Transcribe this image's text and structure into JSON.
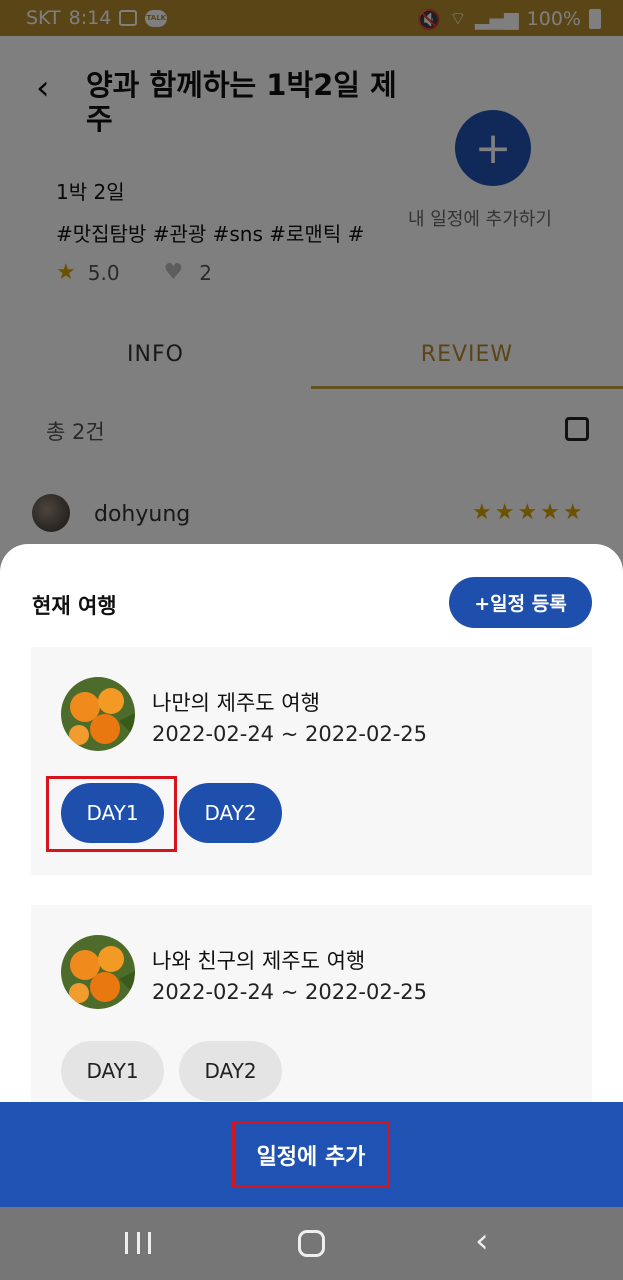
{
  "status_bar": {
    "carrier": "SKT",
    "time": "8:14",
    "battery": "100%",
    "talk_label": "TALK",
    "icons": [
      "gallery-icon",
      "kakaotalk-icon",
      "mute-icon",
      "wifi-icon",
      "signal-icon",
      "battery-icon"
    ]
  },
  "header": {
    "title": "양과 함께하는 1박2일 제주",
    "add_plan_label": "내 일정에 추가하기"
  },
  "trip_info": {
    "duration": "1박 2일",
    "tags": "#맛집탐방 #관광 #sns #로맨틱 #",
    "rating": "5.0",
    "likes": "2"
  },
  "tabs": [
    {
      "label": "INFO",
      "active": false
    },
    {
      "label": "REVIEW",
      "active": true
    }
  ],
  "reviews": {
    "count_label": "총 2건",
    "items": [
      {
        "user": "dohyung",
        "stars": "★★★★★"
      }
    ]
  },
  "sheet": {
    "title": "현재 여행",
    "register_label": "+일정 등록",
    "trips": [
      {
        "name": "나만의 제주도 여행",
        "dates": "2022-02-24 ~ 2022-02-25",
        "days": [
          {
            "label": "DAY1",
            "selected": true
          },
          {
            "label": "DAY2",
            "selected": true
          }
        ]
      },
      {
        "name": "나와 친구의 제주도 여행",
        "dates": "2022-02-24 ~ 2022-02-25",
        "days": [
          {
            "label": "DAY1",
            "selected": false
          },
          {
            "label": "DAY2",
            "selected": false
          }
        ]
      }
    ]
  },
  "footer": {
    "add_label": "일정에 추가"
  },
  "colors": {
    "accent": "#2052b3",
    "brand_gold": "#b58a2e",
    "highlight": "#d6141c"
  }
}
